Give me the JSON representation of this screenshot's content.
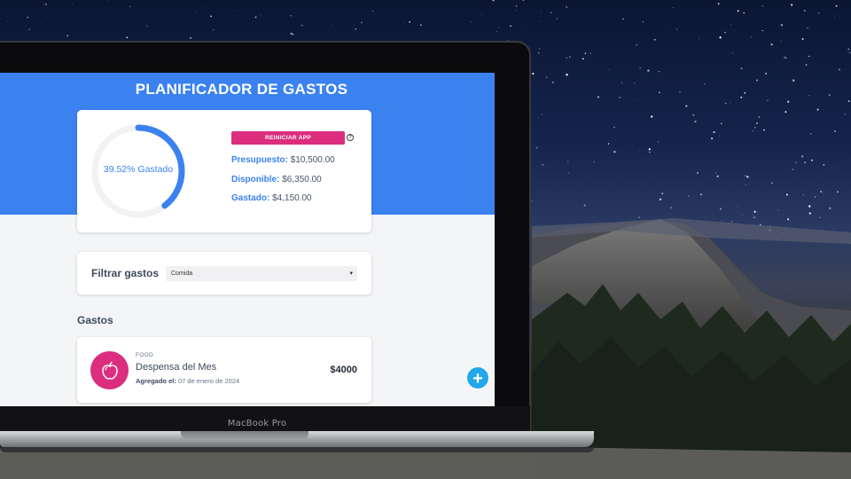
{
  "app": {
    "title": "PLANIFICADOR DE GASTOS",
    "progress": {
      "percent": 39.52,
      "label": "39.52% Gastado"
    },
    "reset_button": "REINICIAR APP",
    "help_icon": "?",
    "stats": [
      {
        "label": "Presupuesto:",
        "value": "$10,500.00"
      },
      {
        "label": "Disponible:",
        "value": "$6,350.00"
      },
      {
        "label": "Gastado:",
        "value": "$4,150.00"
      }
    ],
    "filter": {
      "label": "Filtrar gastos",
      "selected": "Comida",
      "caret": "▾"
    },
    "expenses_title": "Gastos",
    "expenses": [
      {
        "category": "FOOD",
        "name": "Despensa del Mes",
        "date_label": "Agregado el:",
        "date": "07 de enero de 2024",
        "amount": "$4000",
        "icon": "apple-icon"
      }
    ],
    "add_button": "+"
  },
  "device": {
    "brand": "MacBook Pro"
  },
  "colors": {
    "primary": "#3b82f0",
    "accent": "#dc2d7f",
    "add_button": "#22a7ea",
    "screen_bg": "#f4f5f7"
  }
}
